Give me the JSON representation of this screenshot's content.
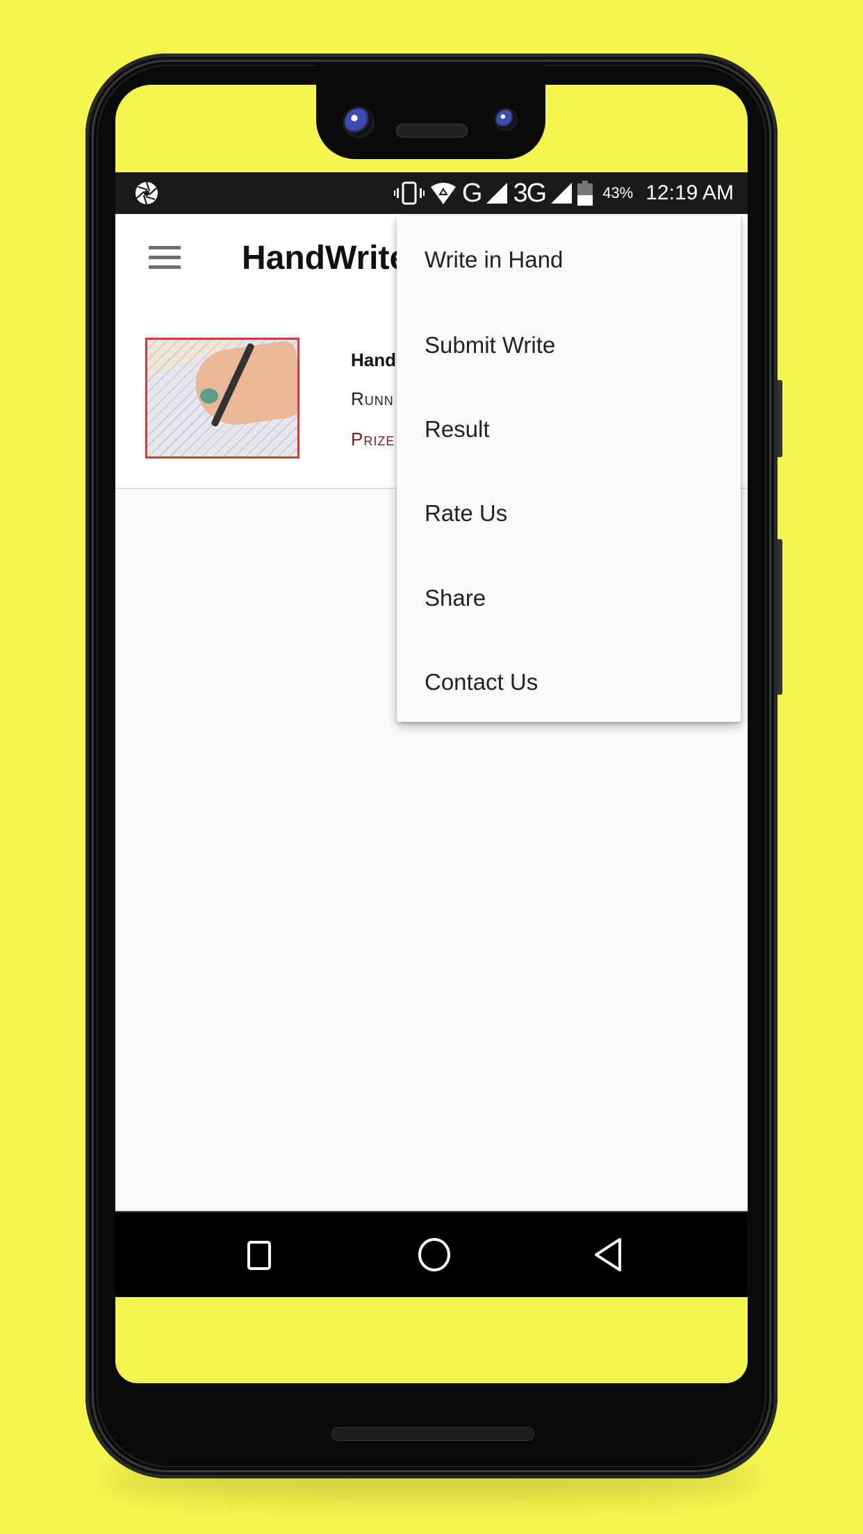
{
  "status_bar": {
    "left_icon": "aperture-icon",
    "icons": [
      "vibrate-icon",
      "wifi-icon",
      "signal-icon",
      "signal-icon"
    ],
    "network_1": "G",
    "network_2": "3G",
    "battery_percent": "43%",
    "time": "12:19 AM"
  },
  "toolbar": {
    "menu_icon": "hamburger-icon",
    "title": "HandWrite"
  },
  "card": {
    "title": "Hand",
    "subtitle": "Runn",
    "prize": "Prize"
  },
  "overflow_menu": {
    "items": [
      {
        "label": "Write in Hand"
      },
      {
        "label": "Submit Write"
      },
      {
        "label": "Result"
      },
      {
        "label": "Rate Us"
      },
      {
        "label": "Share"
      },
      {
        "label": "Contact Us"
      }
    ]
  },
  "nav_bar": {
    "recent_icon": "square-icon",
    "home_icon": "circle-icon",
    "back_icon": "triangle-back-icon"
  },
  "colors": {
    "background": "#f4f54e",
    "thumb_border": "#d9363a",
    "prize_text": "#7a1f1f"
  }
}
